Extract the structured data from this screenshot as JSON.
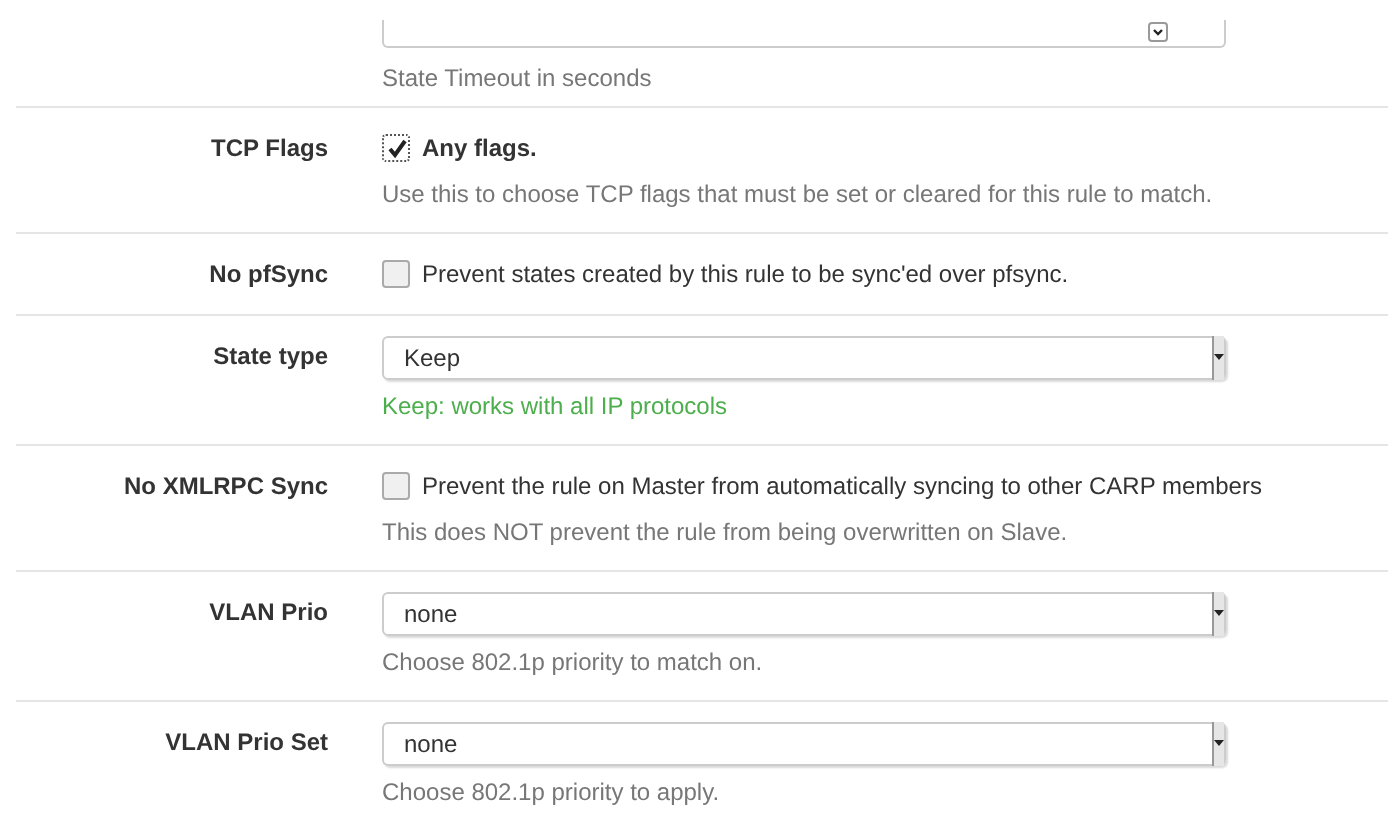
{
  "rows": [
    {
      "kind": "number",
      "help": {
        "text": "State Timeout in seconds",
        "kind": "muted"
      }
    },
    {
      "kind": "checkbox",
      "label": "TCP Flags",
      "checked": true,
      "option": "Any flags.",
      "option_bold": true,
      "help": {
        "text": "Use this to choose TCP flags that must be set or cleared for this rule to match.",
        "kind": "muted"
      }
    },
    {
      "kind": "checkbox",
      "label": "No pfSync",
      "checked": false,
      "option": "Prevent states created by this rule to be sync'ed over pfsync.",
      "option_bold": false
    },
    {
      "kind": "select",
      "label": "State type",
      "value": "Keep",
      "help": {
        "text": "Keep: works with all IP protocols",
        "kind": "success"
      }
    },
    {
      "kind": "checkbox",
      "label": "No XMLRPC Sync",
      "checked": false,
      "option": "Prevent the rule on Master from automatically syncing to other CARP members",
      "option_bold": false,
      "help": {
        "text": "This does NOT prevent the rule from being overwritten on Slave.",
        "kind": "muted"
      }
    },
    {
      "kind": "select",
      "label": "VLAN Prio",
      "value": "none",
      "help": {
        "text": "Choose 802.1p priority to match on.",
        "kind": "muted"
      }
    },
    {
      "kind": "select",
      "label": "VLAN Prio Set",
      "value": "none",
      "help": {
        "text": "Choose 802.1p priority to apply.",
        "kind": "muted"
      }
    }
  ]
}
